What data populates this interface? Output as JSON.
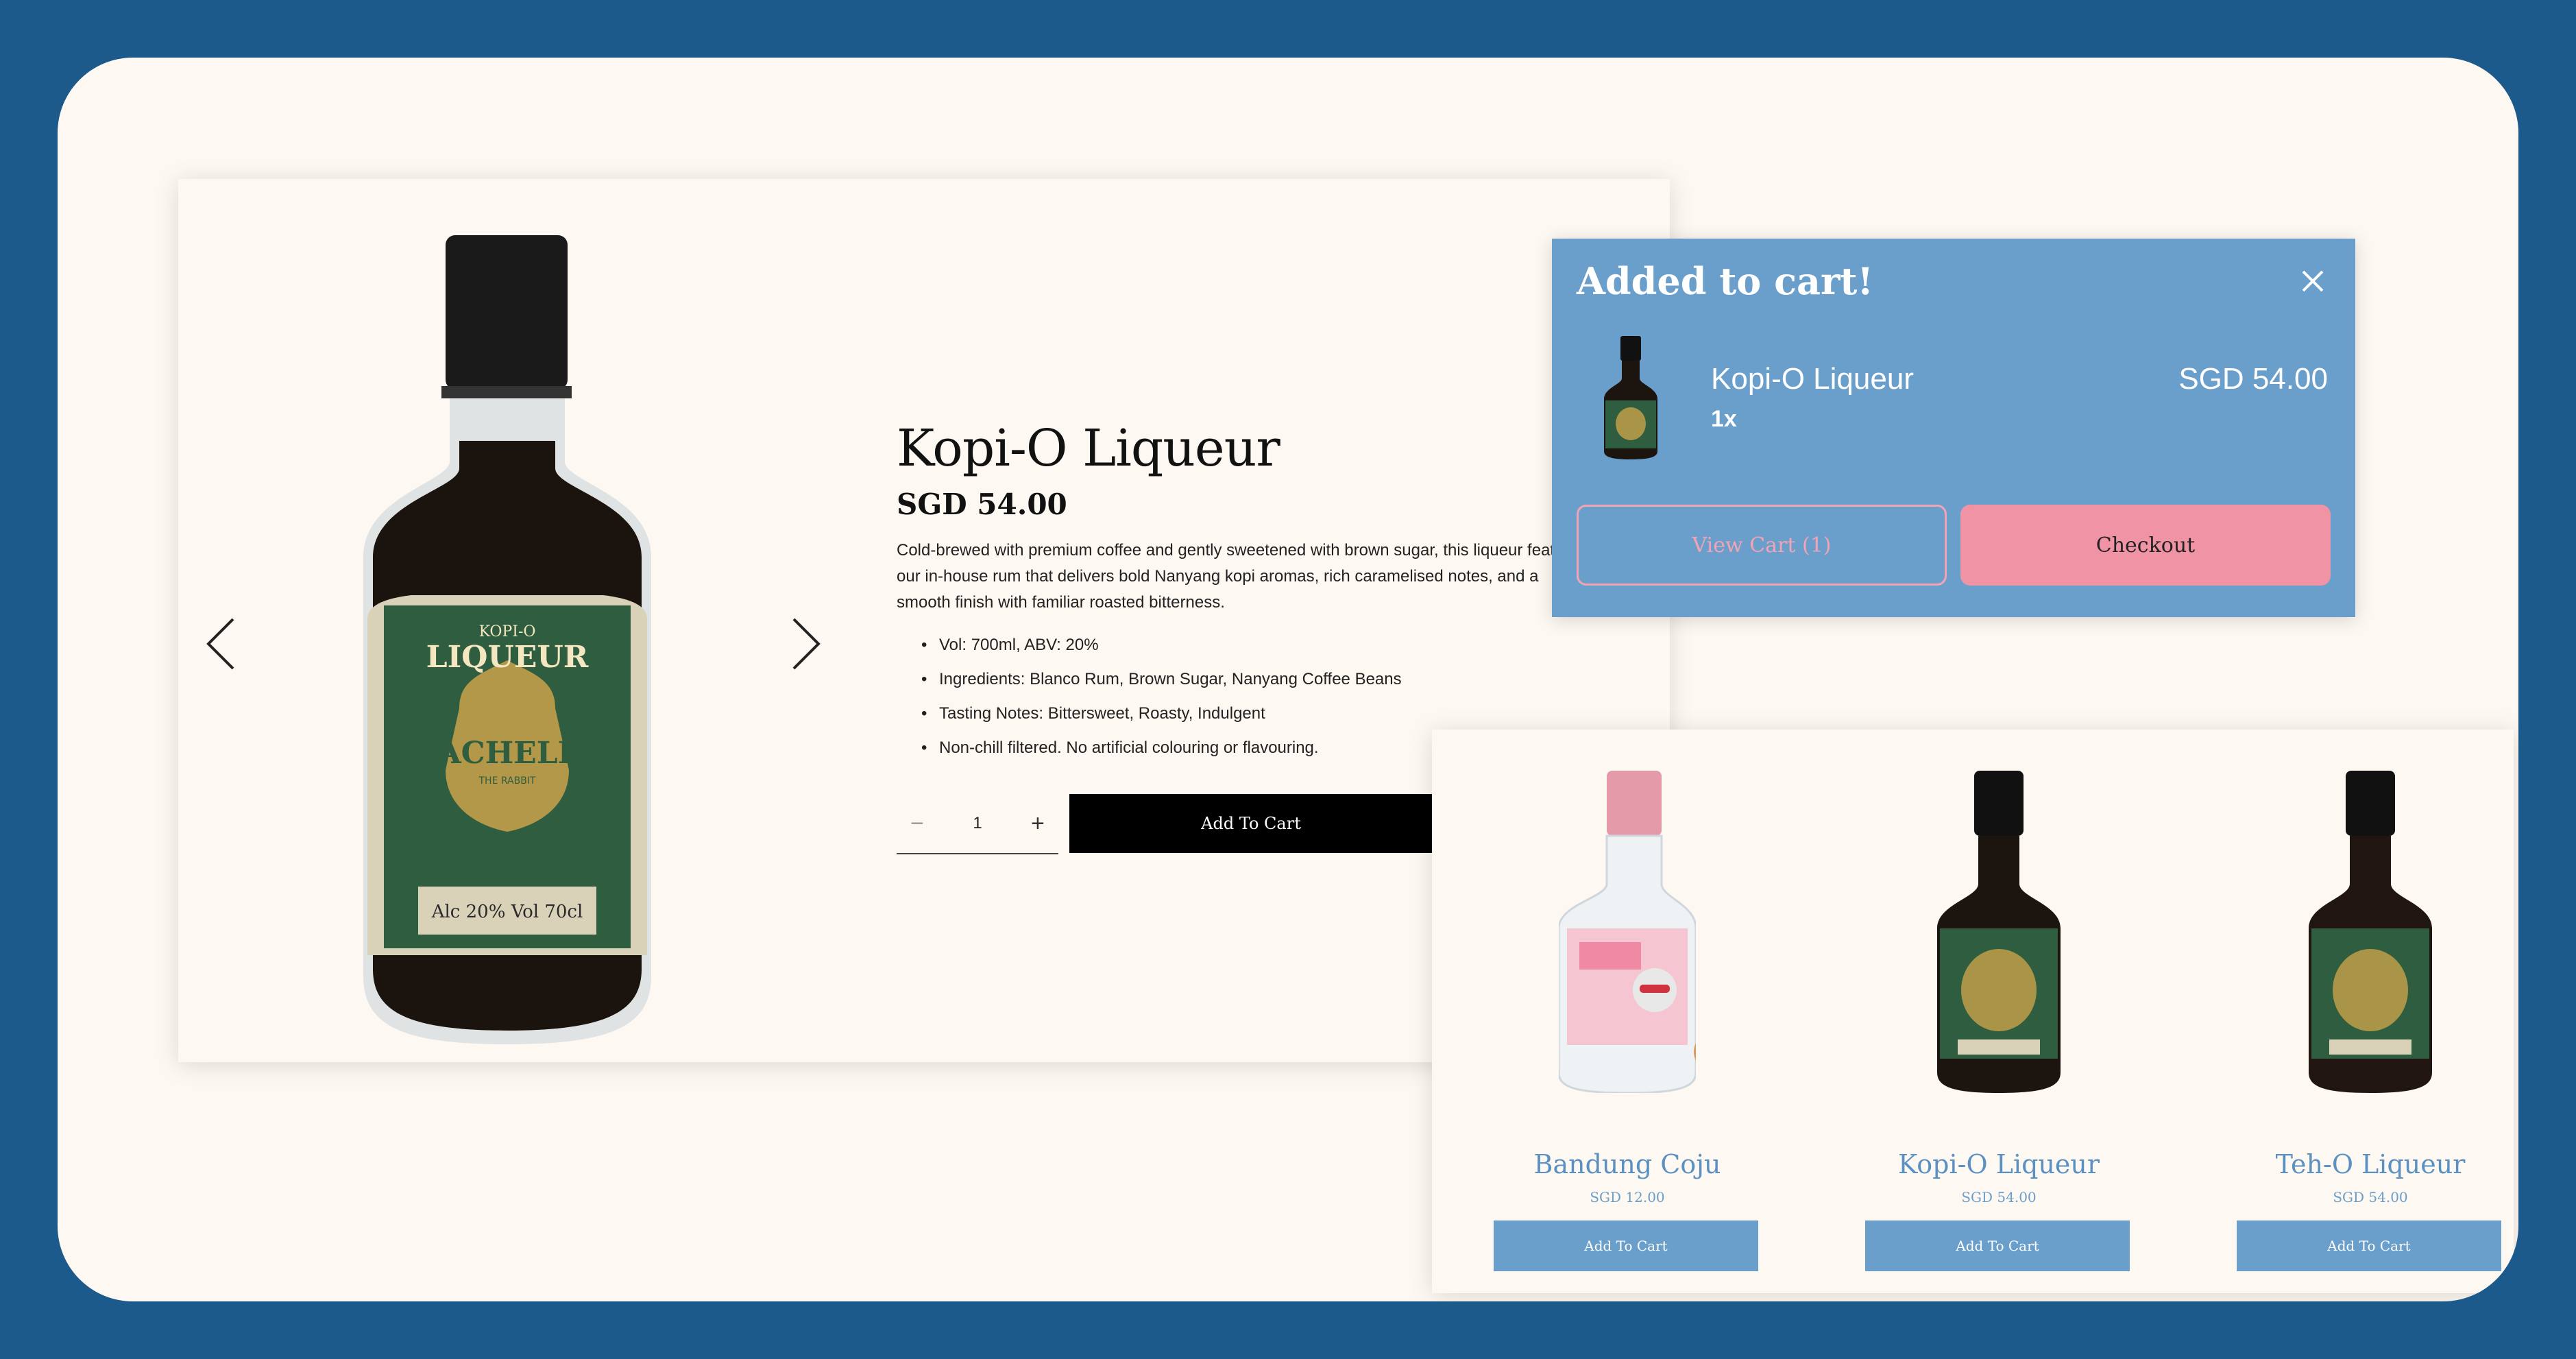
{
  "product": {
    "title": "Kopi-O Liqueur",
    "price": "SGD 54.00",
    "description": "Cold-brewed with premium coffee and gently sweetened with brown sugar, this liqueur features our in-house rum that delivers bold Nanyang kopi aromas, rich caramelised notes, and a smooth finish with familiar roasted bitterness.",
    "details": [
      "Vol: 700ml, ABV: 20%",
      "Ingredients: Blanco Rum, Brown Sugar, Nanyang Coffee Beans",
      "Tasting Notes: Bittersweet, Roasty, Indulgent",
      "Non-chill filtered. No artificial colouring or flavouring."
    ],
    "quantity": "1",
    "qty_minus": "−",
    "qty_plus": "+",
    "add_to_cart_label": "Add To Cart",
    "label_brand": "KOPI-O",
    "label_product": "LIQUEUR",
    "label_maker": "RACHELLE",
    "label_sub": "THE RABBIT",
    "label_abv": "Alc 20% Vol 70cl"
  },
  "cart_popup": {
    "title": "Added to cart!",
    "item_name": "Kopi-O Liqueur",
    "item_qty": "1x",
    "item_price": "SGD 54.00",
    "view_cart_label": "View Cart (1)",
    "checkout_label": "Checkout"
  },
  "related": [
    {
      "name": "Bandung Coju",
      "price": "SGD 12.00",
      "button": "Add To Cart",
      "cap": "#e49aa8",
      "liquid": "#f4f7fa",
      "label": "#f08aa4"
    },
    {
      "name": "Kopi-O Liqueur",
      "price": "SGD 54.00",
      "button": "Add To Cart",
      "cap": "#111111",
      "liquid": "#1c140e",
      "label": "#2f5d3f"
    },
    {
      "name": "Teh-O Liqueur",
      "price": "SGD 54.00",
      "button": "Add To Cart",
      "cap": "#111111",
      "liquid": "#201510",
      "label": "#2f5d3f"
    }
  ],
  "colors": {
    "background": "#1c5a8c",
    "panel": "#fdf8f1",
    "accent_blue": "#6a9fcc",
    "accent_pink": "#ef93a5"
  }
}
